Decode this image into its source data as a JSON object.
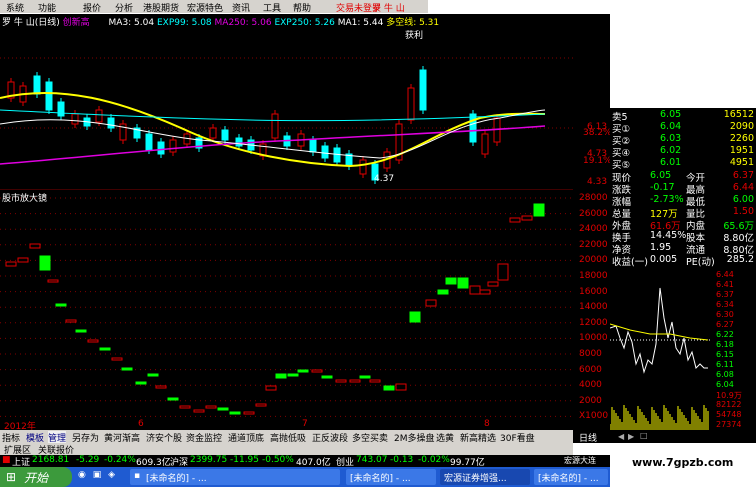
{
  "menu": [
    "系统",
    "功能",
    "报价",
    "分析",
    "港股期货",
    "宏源特色",
    "资讯",
    "工具",
    "帮助"
  ],
  "login_text": "交易未登录",
  "logo_text": "罗 牛 山",
  "chart_header": {
    "stock": "罗 牛 山(日线)",
    "tag": "创新高",
    "ma3": "MA3: 5.04",
    "exp99": "EXP99: 5.08",
    "ma250": "MA250: 5.06",
    "exp250": "EXP250: 5.26",
    "ma1": "MA1: 5.44",
    "duokong": "多空线: 5.31",
    "profit": "获利"
  },
  "annotations": {
    "low": "4.37"
  },
  "price_axis": [
    "6.13",
    "38.2%",
    "4.73",
    "19.1%",
    "4.33"
  ],
  "ind_title": "股市放大镜",
  "ind_axis": [
    "28000",
    "26000",
    "24000",
    "22000",
    "20000",
    "18000",
    "16000",
    "14000",
    "12000",
    "10000",
    "8000",
    "6000",
    "4000",
    "2000",
    "X1000"
  ],
  "x_labels": [
    "2012年",
    "6",
    "7",
    "8"
  ],
  "quote": {
    "asks": [
      {
        "label": "卖5",
        "price": "6.05",
        "vol": "16512"
      },
      {
        "label": "买①",
        "price": "6.04",
        "vol": "2090"
      },
      {
        "label": "买②",
        "price": "6.03",
        "vol": "2260"
      },
      {
        "label": "买④",
        "price": "6.02",
        "vol": "1951"
      },
      {
        "label": "买⑤",
        "price": "6.01",
        "vol": "4951"
      }
    ],
    "rows": [
      {
        "k1": "现价",
        "v1": "6.05",
        "k2": "今开",
        "v2": "6.37"
      },
      {
        "k1": "涨跌",
        "v1": "-0.17",
        "k2": "最高",
        "v2": "6.44"
      },
      {
        "k1": "涨幅",
        "v1": "-2.73%",
        "k2": "最低",
        "v2": "6.00"
      },
      {
        "k1": "总量",
        "v1": "127万",
        "k2": "量比",
        "v2": "1.50"
      },
      {
        "k1": "外盘",
        "v1": "61.6万",
        "k2": "内盘",
        "v2": "65.6万"
      },
      {
        "k1": "换手",
        "v1": "14.45%",
        "k2": "股本",
        "v2": "8.80亿"
      },
      {
        "k1": "净资",
        "v1": "1.95",
        "k2": "流通",
        "v2": "8.80亿"
      },
      {
        "k1": "收益(一)",
        "v1": "0.005",
        "k2": "PE(动)",
        "v2": "285.2"
      }
    ]
  },
  "mini_axis": [
    "6.44",
    "6.41",
    "6.37",
    "6.34",
    "6.30",
    "6.27",
    "6.22",
    "6.18",
    "6.15",
    "6.11",
    "6.08",
    "6.04",
    "10.9万",
    "82122",
    "54748",
    "27374"
  ],
  "tick_window": "日线",
  "tabs": [
    "指标",
    "模板",
    "管理",
    "另存为",
    "黄河渐高",
    "济安个股",
    "资金监控",
    "通道顶底",
    "高抛低吸",
    "正反波段",
    "多空买卖",
    "2M多操盘",
    "选黄",
    "新高精选",
    "30F看盘"
  ],
  "subtabs": [
    "扩展区",
    "关联报价"
  ],
  "index_bar": {
    "sh_label": "上证",
    "sh_value": "2168.81",
    "sh_chg": "-5.29",
    "sh_pct": "-0.24%",
    "sh_amt": "609.3亿",
    "hs_label": "沪深",
    "hs_value": "2399.75",
    "hs_chg": "-11.95",
    "hs_pct": "-0.50%",
    "hs_amt": "407.0亿",
    "cy_label": "创业",
    "cy_value": "743.07",
    "cy_chg": "-0.13",
    "cy_pct": "-0.02%",
    "cy_amt": "99.77亿"
  },
  "taskbar": {
    "start": "开始",
    "items": [
      "[未命名的] - ...",
      "宏源证券增强...",
      "[未命名的] - ...",
      "宏源大连行..."
    ]
  },
  "watermark": "www.7gpzb.com"
}
